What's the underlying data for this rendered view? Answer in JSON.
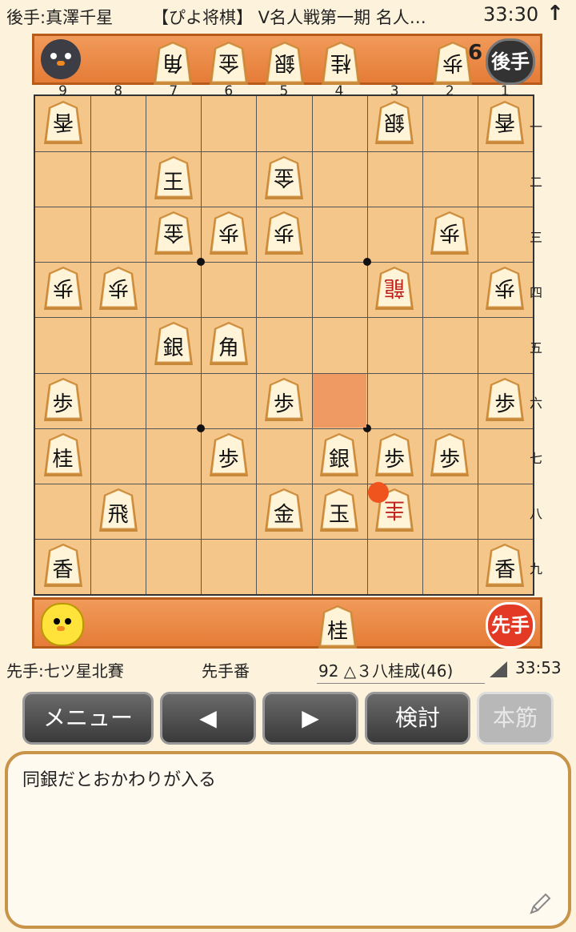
{
  "header": {
    "gote_player": "後手:真澤千星",
    "title": "【ぴよ将棋】 V名人戦第一期  名人…",
    "clock": "33:30",
    "arrow": "↑"
  },
  "gote_stand": {
    "badge": "後手",
    "pieces": [
      "角",
      "金",
      "銀",
      "桂",
      "歩"
    ],
    "pawn_count": "6"
  },
  "board": {
    "file_labels": [
      "9",
      "8",
      "7",
      "6",
      "5",
      "4",
      "3",
      "2",
      "1"
    ],
    "rank_labels": [
      "一",
      "二",
      "三",
      "四",
      "五",
      "六",
      "七",
      "八",
      "九"
    ],
    "pieces": [
      {
        "label": "香",
        "file": 9,
        "rank": 1,
        "side": "gote",
        "promoted": false
      },
      {
        "label": "銀",
        "file": 3,
        "rank": 1,
        "side": "gote",
        "promoted": false
      },
      {
        "label": "香",
        "file": 1,
        "rank": 1,
        "side": "gote",
        "promoted": false
      },
      {
        "label": "王",
        "file": 7,
        "rank": 2,
        "side": "sente",
        "promoted": false
      },
      {
        "label": "金",
        "file": 5,
        "rank": 2,
        "side": "gote",
        "promoted": false
      },
      {
        "label": "金",
        "file": 7,
        "rank": 3,
        "side": "gote",
        "promoted": false
      },
      {
        "label": "歩",
        "file": 6,
        "rank": 3,
        "side": "gote",
        "promoted": false
      },
      {
        "label": "歩",
        "file": 5,
        "rank": 3,
        "side": "gote",
        "promoted": false
      },
      {
        "label": "歩",
        "file": 2,
        "rank": 3,
        "side": "gote",
        "promoted": false
      },
      {
        "label": "歩",
        "file": 9,
        "rank": 4,
        "side": "gote",
        "promoted": false
      },
      {
        "label": "歩",
        "file": 8,
        "rank": 4,
        "side": "gote",
        "promoted": false
      },
      {
        "label": "龍",
        "file": 3,
        "rank": 4,
        "side": "gote",
        "promoted": true
      },
      {
        "label": "歩",
        "file": 1,
        "rank": 4,
        "side": "gote",
        "promoted": false
      },
      {
        "label": "銀",
        "file": 7,
        "rank": 5,
        "side": "sente",
        "promoted": false
      },
      {
        "label": "角",
        "file": 6,
        "rank": 5,
        "side": "sente",
        "promoted": false
      },
      {
        "label": "歩",
        "file": 9,
        "rank": 6,
        "side": "sente",
        "promoted": false
      },
      {
        "label": "歩",
        "file": 5,
        "rank": 6,
        "side": "sente",
        "promoted": false
      },
      {
        "label": "歩",
        "file": 1,
        "rank": 6,
        "side": "sente",
        "promoted": false
      },
      {
        "label": "桂",
        "file": 9,
        "rank": 7,
        "side": "sente",
        "promoted": false
      },
      {
        "label": "歩",
        "file": 6,
        "rank": 7,
        "side": "sente",
        "promoted": false
      },
      {
        "label": "銀",
        "file": 4,
        "rank": 7,
        "side": "sente",
        "promoted": false
      },
      {
        "label": "歩",
        "file": 3,
        "rank": 7,
        "side": "sente",
        "promoted": false
      },
      {
        "label": "歩",
        "file": 2,
        "rank": 7,
        "side": "sente",
        "promoted": false
      },
      {
        "label": "飛",
        "file": 8,
        "rank": 8,
        "side": "sente",
        "promoted": false
      },
      {
        "label": "金",
        "file": 5,
        "rank": 8,
        "side": "sente",
        "promoted": false
      },
      {
        "label": "玉",
        "file": 4,
        "rank": 8,
        "side": "sente",
        "promoted": false
      },
      {
        "label": "圭",
        "file": 3,
        "rank": 8,
        "side": "gote",
        "promoted": true
      },
      {
        "label": "香",
        "file": 9,
        "rank": 9,
        "side": "sente",
        "promoted": false
      },
      {
        "label": "香",
        "file": 1,
        "rank": 9,
        "side": "sente",
        "promoted": false
      }
    ],
    "last_move_highlight": {
      "file": 4,
      "rank": 6
    },
    "move_marker": {
      "file": 3,
      "rank": 8
    }
  },
  "sente_stand": {
    "badge": "先手",
    "pieces": [
      "桂"
    ]
  },
  "info": {
    "sente_player": "先手:七ツ星北賽",
    "turn": "先手番",
    "move": "92 △３八桂成(46)",
    "clock": "33:53"
  },
  "buttons": {
    "menu": "メニュー",
    "prev": "◀",
    "next": "▶",
    "analyze": "検討",
    "mainline": "本筋"
  },
  "comment": {
    "text": "同銀だとおかわりが入る"
  },
  "colors": {
    "board": "#f4c68a",
    "stand": "#e57c37",
    "highlight": "#ef9a62",
    "marker": "#f0541e",
    "promoted": "#c0201a"
  }
}
